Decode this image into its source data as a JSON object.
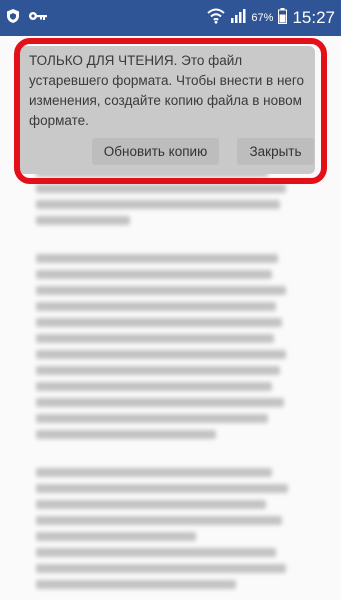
{
  "status_bar": {
    "battery_percent": "67%",
    "time": "15:27",
    "icons": [
      "shield-icon",
      "key-icon",
      "wifi-icon",
      "signal-icon",
      "battery-icon"
    ]
  },
  "banner": {
    "message": "ТОЛЬКО ДЛЯ ЧТЕНИЯ. Это файл устаревшего формата. Чтобы внести в него изменения, создайте копию файла в новом формате.",
    "refresh_label": "Обновить копию",
    "close_label": "Закрыть"
  },
  "colors": {
    "status_bar": "#2f5596",
    "banner_bg": "#c9c9c9",
    "highlight": "#e3101a"
  }
}
